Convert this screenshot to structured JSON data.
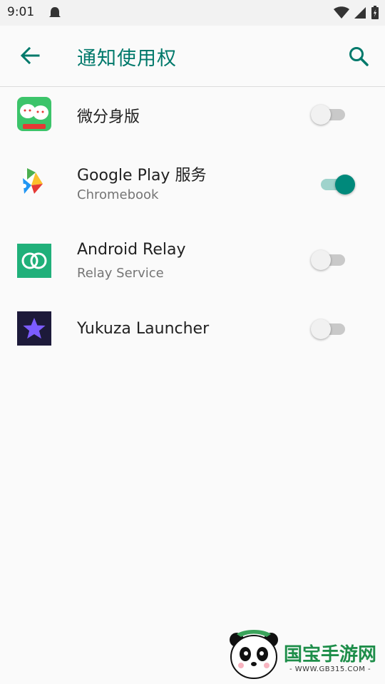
{
  "status_bar": {
    "time": "9:01"
  },
  "header": {
    "title": "通知使用权"
  },
  "apps": [
    {
      "name": "微分身版",
      "subtitle": "",
      "enabled": false,
      "icon": "dual-chat-app-icon"
    },
    {
      "name": "Google Play 服务",
      "subtitle": "Chromebook",
      "enabled": true,
      "icon": "google-play-services-icon"
    },
    {
      "name": "Android Relay",
      "subtitle": "Relay Service",
      "enabled": false,
      "icon": "relay-rings-icon"
    },
    {
      "name": "Yukuza Launcher",
      "subtitle": "",
      "enabled": false,
      "icon": "star-launcher-icon"
    }
  ],
  "watermark": {
    "brand": "国宝手游网",
    "url": "- WWW.GB315.COM -"
  },
  "colors": {
    "accent": "#00796b",
    "toggle_on": "#00897b"
  }
}
